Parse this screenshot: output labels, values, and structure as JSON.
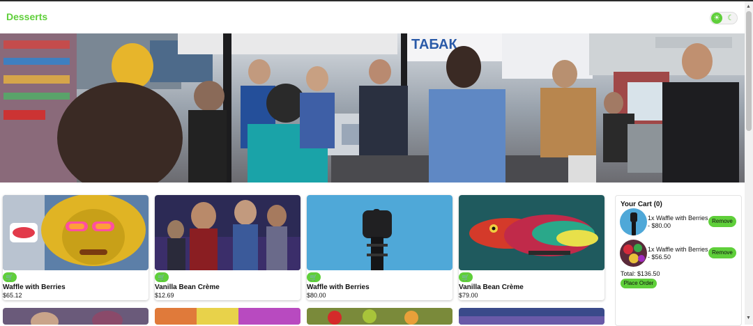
{
  "app": {
    "title": "Desserts"
  },
  "theme_toggle": {
    "light_icon": "sun-icon",
    "dark_icon": "moon-icon",
    "light_glyph": "☀",
    "dark_glyph": "☾"
  },
  "hero": {
    "subject": "supermarket-checkout-photo",
    "sign_text": "ТАБАК"
  },
  "products": [
    {
      "name": "Waffle with Berries",
      "price": "$65.12",
      "cart_glyph": "🛒",
      "image": "monkey-graffiti"
    },
    {
      "name": "Vanilla Bean Crème",
      "price": "$12.69",
      "cart_glyph": "🛒",
      "image": "superhero-poster"
    },
    {
      "name": "Waffle with Berries",
      "price": "$80.00",
      "cart_glyph": "🛒",
      "image": "robot-hand"
    },
    {
      "name": "Vanilla Bean Crème",
      "price": "$79.00",
      "cart_glyph": "🛒",
      "image": "chameleon"
    }
  ],
  "cart": {
    "title": "Your Cart (0)",
    "items": [
      {
        "qty_name": "1x Waffle with Berries",
        "price": "- $80.00",
        "remove_label": "Remove",
        "image": "robot-hand"
      },
      {
        "qty_name": "1x Waffle with Berries",
        "price": "- $56.50",
        "remove_label": "Remove",
        "image": "berries"
      }
    ],
    "total": "Total: $136.50",
    "place_order_label": "Place Order"
  },
  "colors": {
    "accent": "#5fcf3a",
    "text": "#111111",
    "background": "#ffffff"
  }
}
